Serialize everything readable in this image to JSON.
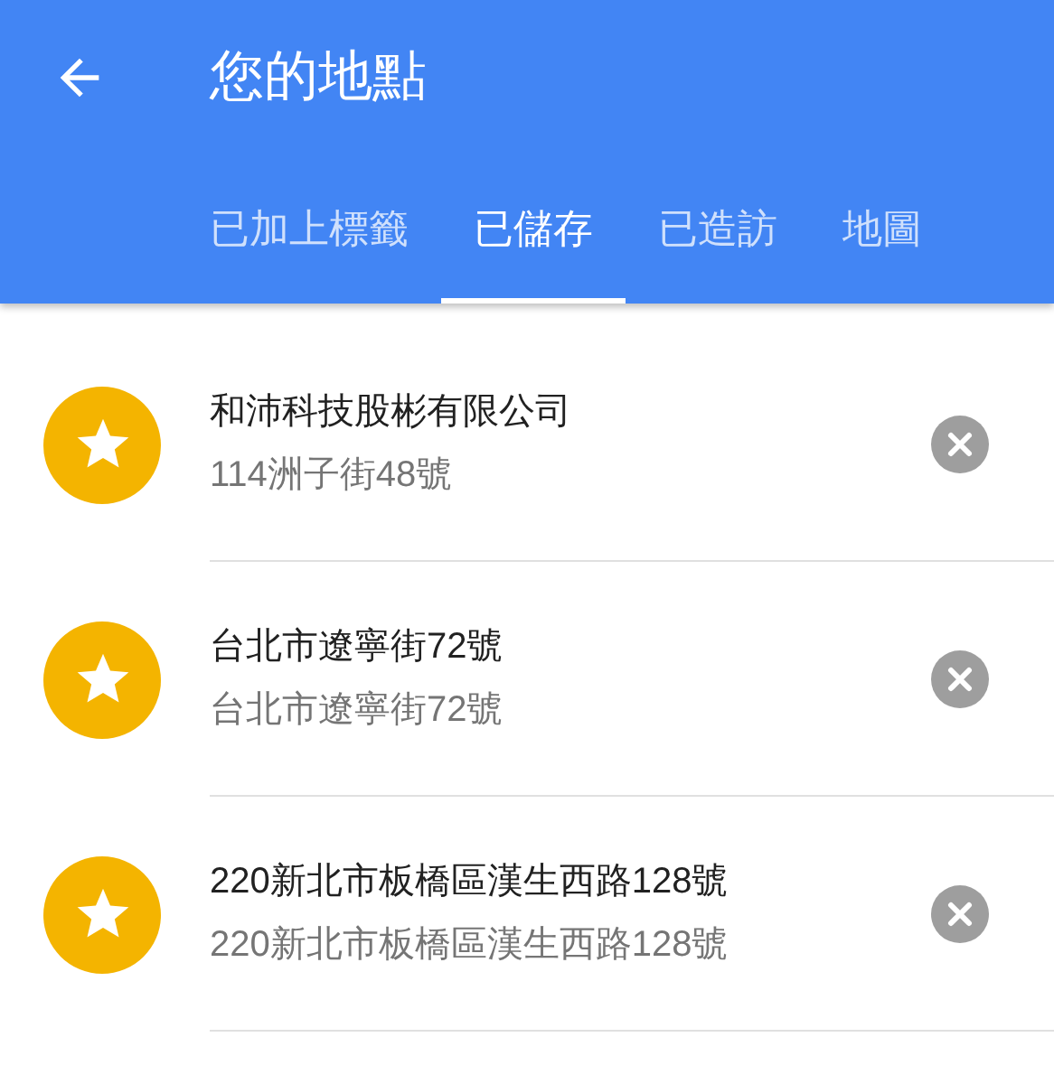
{
  "header": {
    "title": "您的地點"
  },
  "tabs": [
    {
      "label": "已加上標籤",
      "selected": false
    },
    {
      "label": "已儲存",
      "selected": true
    },
    {
      "label": "已造訪",
      "selected": false
    },
    {
      "label": "地圖",
      "selected": false
    }
  ],
  "places": [
    {
      "name": "和沛科技股彬有限公司",
      "address": "114洲子街48號"
    },
    {
      "name": "台北市遼寧街72號",
      "address": "台北市遼寧街72號"
    },
    {
      "name": "220新北市板橋區漢生西路128號",
      "address": "220新北市板橋區漢生西路128號"
    }
  ]
}
